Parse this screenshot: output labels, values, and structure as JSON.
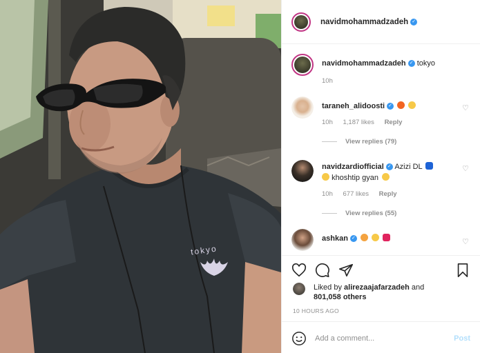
{
  "post": {
    "owner": "navidmohammadzadeh",
    "caption": "tokyo",
    "caption_time": "10h",
    "shirt_text": "tokyo"
  },
  "comments": [
    {
      "user": "taraneh_alidoosti",
      "text": "",
      "time": "10h",
      "likes": "1,187 likes",
      "reply": "Reply",
      "view_replies": "View replies (79)"
    },
    {
      "user": "navidzardiofficial",
      "text_line1": "Azizi DL",
      "text_line2": "khoshtip gyan",
      "time": "10h",
      "likes": "677 likes",
      "reply": "Reply",
      "view_replies": "View replies (55)"
    },
    {
      "user": "ashkan",
      "text": ""
    }
  ],
  "likes": {
    "prefix": "Liked by ",
    "user": "alirezaajafarzadeh",
    "and": " and",
    "count": "801,058 others"
  },
  "timestamp": "10 HOURS AGO",
  "add_comment": {
    "placeholder": "Add a comment...",
    "post_label": "Post"
  },
  "icons": {
    "verified": "verified-badge-icon",
    "like": "heart-icon",
    "comment": "comment-bubble-icon",
    "share": "paper-plane-icon",
    "save": "bookmark-icon",
    "emoji": "smiley-icon"
  },
  "colors": {
    "verified": "#3897f0",
    "post_button": "#b2dffc",
    "meta_text": "#8e8e8e"
  }
}
